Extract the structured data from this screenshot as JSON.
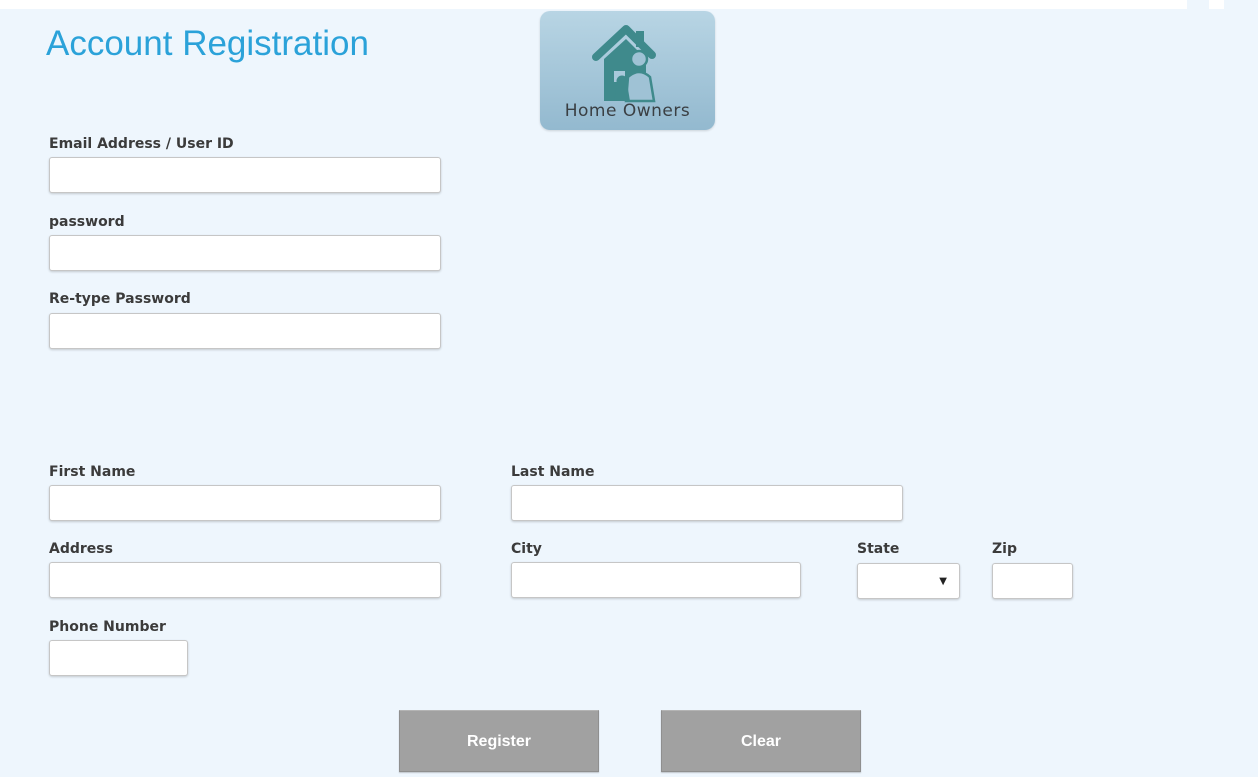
{
  "page": {
    "title": "Account Registration"
  },
  "badge": {
    "label": "Home Owners",
    "icon": "house-family-icon"
  },
  "form": {
    "email": {
      "label": "Email Address / User ID",
      "value": "",
      "placeholder": ""
    },
    "password": {
      "label": "password",
      "value": "",
      "placeholder": ""
    },
    "retype_password": {
      "label": "Re-type Password",
      "value": "",
      "placeholder": ""
    },
    "first_name": {
      "label": "First Name",
      "value": "",
      "placeholder": ""
    },
    "last_name": {
      "label": "Last Name",
      "value": "",
      "placeholder": ""
    },
    "address": {
      "label": "Address",
      "value": "",
      "placeholder": ""
    },
    "city": {
      "label": "City",
      "value": "",
      "placeholder": ""
    },
    "state": {
      "label": "State",
      "selected": ""
    },
    "zip": {
      "label": "Zip",
      "value": "",
      "placeholder": ""
    },
    "phone": {
      "label": "Phone Number",
      "value": "",
      "placeholder": ""
    }
  },
  "actions": {
    "register_label": "Register",
    "clear_label": "Clear"
  },
  "colors": {
    "background": "#eef6fd",
    "title": "#2ba2d9",
    "button": "#a1a1a1",
    "badge": "#a7c7da",
    "icon_teal": "#3f8a8c"
  }
}
